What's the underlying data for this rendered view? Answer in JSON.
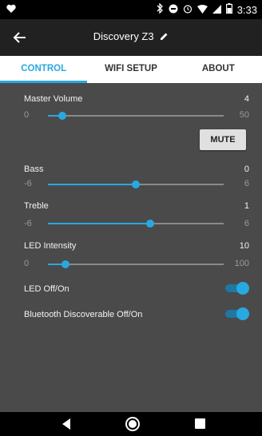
{
  "status_bar": {
    "time": "3:33",
    "icons": [
      "heart-icon",
      "bluetooth-icon",
      "do-not-disturb-icon",
      "alarm-icon",
      "wifi-icon",
      "cell-signal-icon",
      "battery-icon"
    ]
  },
  "app_bar": {
    "title": "Discovery Z3",
    "back_icon": "arrow-back-icon",
    "edit_icon": "pencil-icon"
  },
  "tabs": [
    {
      "label": "CONTROL",
      "active": true
    },
    {
      "label": "WIFI SETUP",
      "active": false
    },
    {
      "label": "ABOUT",
      "active": false
    }
  ],
  "controls": {
    "master_volume": {
      "label": "Master Volume",
      "value": "4",
      "min": "0",
      "max": "50",
      "level": 0.08
    },
    "mute_button": {
      "label": "MUTE"
    },
    "bass": {
      "label": "Bass",
      "value": "0",
      "min": "-6",
      "max": "6",
      "level": 0.5
    },
    "treble": {
      "label": "Treble",
      "value": "1",
      "min": "-6",
      "max": "6",
      "level": 0.583
    },
    "led_intensity": {
      "label": "LED Intensity",
      "value": "10",
      "min": "0",
      "max": "100",
      "level": 0.1
    },
    "led_toggle": {
      "label": "LED Off/On",
      "state": "on"
    },
    "bluetooth_toggle": {
      "label": "Bluetooth Discoverable Off/On",
      "state": "on"
    }
  },
  "colors": {
    "accent": "#29a8e0",
    "background": "#4a4a4a",
    "app_bar": "#212121"
  }
}
